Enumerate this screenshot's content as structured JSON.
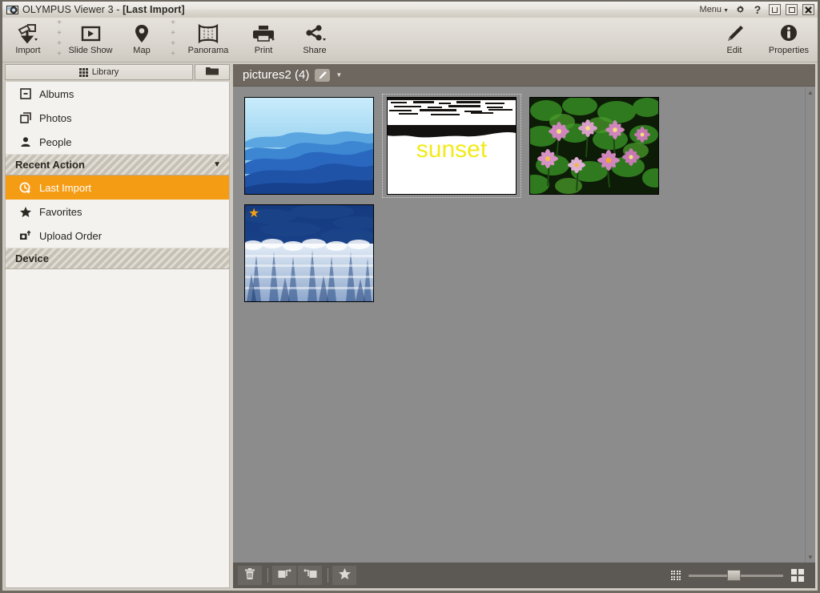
{
  "window": {
    "app_title": "OLYMPUS Viewer 3",
    "title_separator": "-",
    "document_title": "[Last Import]",
    "logo_icon": "camera-lens-icon"
  },
  "titlebar_right": {
    "menu_label": "Menu",
    "menu_caret": "▼",
    "gear_icon": "gear-icon",
    "help_icon": "help-question-icon",
    "minimize_icon": "minimize-icon",
    "maximize_icon": "maximize-icon",
    "close_icon": "close-icon"
  },
  "toolbar": {
    "items": [
      {
        "label": "Import",
        "icon": "import-icon",
        "has_dropdown": true
      },
      {
        "label": "Slide Show",
        "icon": "slideshow-play-icon",
        "has_dropdown": false
      },
      {
        "label": "Map",
        "icon": "map-pin-icon",
        "has_dropdown": false
      },
      {
        "label": "Panorama",
        "icon": "panorama-icon",
        "has_dropdown": false
      },
      {
        "label": "Print",
        "icon": "printer-icon",
        "has_dropdown": true
      },
      {
        "label": "Share",
        "icon": "share-node-icon",
        "has_dropdown": true
      }
    ],
    "right_items": [
      {
        "label": "Edit",
        "icon": "pencil-icon"
      },
      {
        "label": "Properties",
        "icon": "info-circle-icon"
      }
    ],
    "separator_glyph": "+"
  },
  "sidebar": {
    "library_tab": {
      "label": "Library",
      "icon": "grid-9-icon"
    },
    "folder_button": {
      "icon": "folder-icon"
    },
    "items": [
      {
        "type": "item",
        "label": "Albums",
        "icon": "album-icon",
        "active": false
      },
      {
        "type": "item",
        "label": "Photos",
        "icon": "photos-stack-icon",
        "active": false
      },
      {
        "type": "item",
        "label": "People",
        "icon": "person-icon",
        "active": false
      },
      {
        "type": "header",
        "label": "Recent Action",
        "chevron": "▼"
      },
      {
        "type": "item",
        "label": "Last Import",
        "icon": "clock-import-icon",
        "active": true
      },
      {
        "type": "item",
        "label": "Favorites",
        "icon": "star-icon",
        "active": false
      },
      {
        "type": "item",
        "label": "Upload Order",
        "icon": "upload-camera-icon",
        "active": false
      },
      {
        "type": "header",
        "label": "Device",
        "chevron": ""
      }
    ]
  },
  "content": {
    "title": "pictures2 (4)",
    "edit_icon": "pencil-edit-icon",
    "caret": "▼",
    "thumbnails": [
      {
        "name": "blue-mountain-ridges-photo",
        "kind": "mountains",
        "selected": false,
        "favorite": false
      },
      {
        "name": "sunset-text-photo",
        "kind": "sunset",
        "selected": true,
        "favorite": false,
        "caption": "sunset"
      },
      {
        "name": "water-lilies-photo",
        "kind": "lilies",
        "selected": false,
        "favorite": false
      },
      {
        "name": "winter-forest-photo",
        "kind": "winter",
        "selected": false,
        "favorite": true,
        "star": "★"
      }
    ]
  },
  "scrollbar": {
    "up_arrow": "▲",
    "down_arrow": "▼"
  },
  "bottombar": {
    "left_buttons": [
      {
        "label": "Delete",
        "icon": "trash-icon"
      },
      {
        "label": "Rotate Left",
        "icon": "rotate-left-icon"
      },
      {
        "label": "Rotate Right",
        "icon": "rotate-right-icon"
      },
      {
        "label": "Favorite",
        "icon": "star-icon"
      }
    ],
    "zoom_small_icon": "grid-small-icon",
    "zoom_large_icon": "grid-large-icon",
    "zoom_value": 40
  },
  "colors": {
    "accent": "#f59c15",
    "title_bg": "#e8e5df",
    "toolbar_bg": "#dcd8d1",
    "sidebar_bg": "#f4f2ee",
    "content_bg": "#8c8c8c",
    "content_header_bg": "#6e675f",
    "bottombar_bg": "#5c5853",
    "star_gold": "#f0a01a",
    "sunset_text": "#f2ea1a"
  }
}
